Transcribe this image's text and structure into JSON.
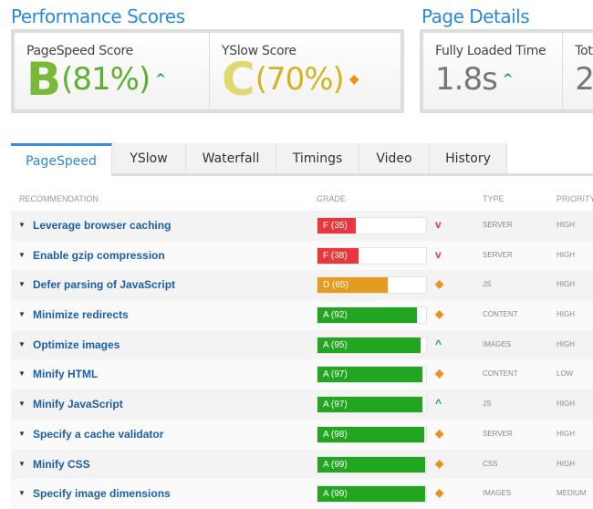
{
  "performance": {
    "title": "Performance Scores",
    "pagespeed": {
      "label": "PageSpeed Score",
      "letter": "B",
      "percent": "(81%)",
      "trend": "up",
      "color": "#6ab42e"
    },
    "yslow": {
      "label": "YSlow Score",
      "letter": "C",
      "percent": "(70%)",
      "trend": "neutral",
      "color": "#d4c02a"
    }
  },
  "details": {
    "title": "Page Details",
    "loaded": {
      "label": "Fully Loaded Time",
      "value": "1.8s",
      "trend": "up"
    },
    "total": {
      "label": "Tot",
      "value": "2"
    }
  },
  "tabs": [
    {
      "label": "PageSpeed"
    },
    {
      "label": "YSlow"
    },
    {
      "label": "Waterfall"
    },
    {
      "label": "Timings"
    },
    {
      "label": "Video"
    },
    {
      "label": "History"
    }
  ],
  "table": {
    "headers": {
      "recommendation": "RECOMMENDATION",
      "grade": "GRADE",
      "type": "TYPE",
      "priority": "PRIORITY"
    },
    "rows": [
      {
        "name": "Leverage browser caching",
        "grade": "F (35)",
        "score": 35,
        "color": "#e8383d",
        "trend": "down",
        "type": "SERVER",
        "priority": "HIGH"
      },
      {
        "name": "Enable gzip compression",
        "grade": "F (38)",
        "score": 38,
        "color": "#e8383d",
        "trend": "down",
        "type": "SERVER",
        "priority": "HIGH"
      },
      {
        "name": "Defer parsing of JavaScript",
        "grade": "D (65)",
        "score": 65,
        "color": "#e39b20",
        "trend": "neutral",
        "type": "JS",
        "priority": "HIGH"
      },
      {
        "name": "Minimize redirects",
        "grade": "A (92)",
        "score": 92,
        "color": "#22a622",
        "trend": "neutral",
        "type": "CONTENT",
        "priority": "HIGH"
      },
      {
        "name": "Optimize images",
        "grade": "A (95)",
        "score": 95,
        "color": "#22a622",
        "trend": "up",
        "type": "IMAGES",
        "priority": "HIGH"
      },
      {
        "name": "Minify HTML",
        "grade": "A (97)",
        "score": 97,
        "color": "#22a622",
        "trend": "neutral",
        "type": "CONTENT",
        "priority": "LOW"
      },
      {
        "name": "Minify JavaScript",
        "grade": "A (97)",
        "score": 97,
        "color": "#22a622",
        "trend": "up",
        "type": "JS",
        "priority": "HIGH"
      },
      {
        "name": "Specify a cache validator",
        "grade": "A (98)",
        "score": 98,
        "color": "#22a622",
        "trend": "neutral",
        "type": "SERVER",
        "priority": "HIGH"
      },
      {
        "name": "Minify CSS",
        "grade": "A (99)",
        "score": 99,
        "color": "#22a622",
        "trend": "neutral",
        "type": "CSS",
        "priority": "HIGH"
      },
      {
        "name": "Specify image dimensions",
        "grade": "A (99)",
        "score": 99,
        "color": "#22a622",
        "trend": "neutral",
        "type": "IMAGES",
        "priority": "MEDIUM"
      }
    ]
  }
}
